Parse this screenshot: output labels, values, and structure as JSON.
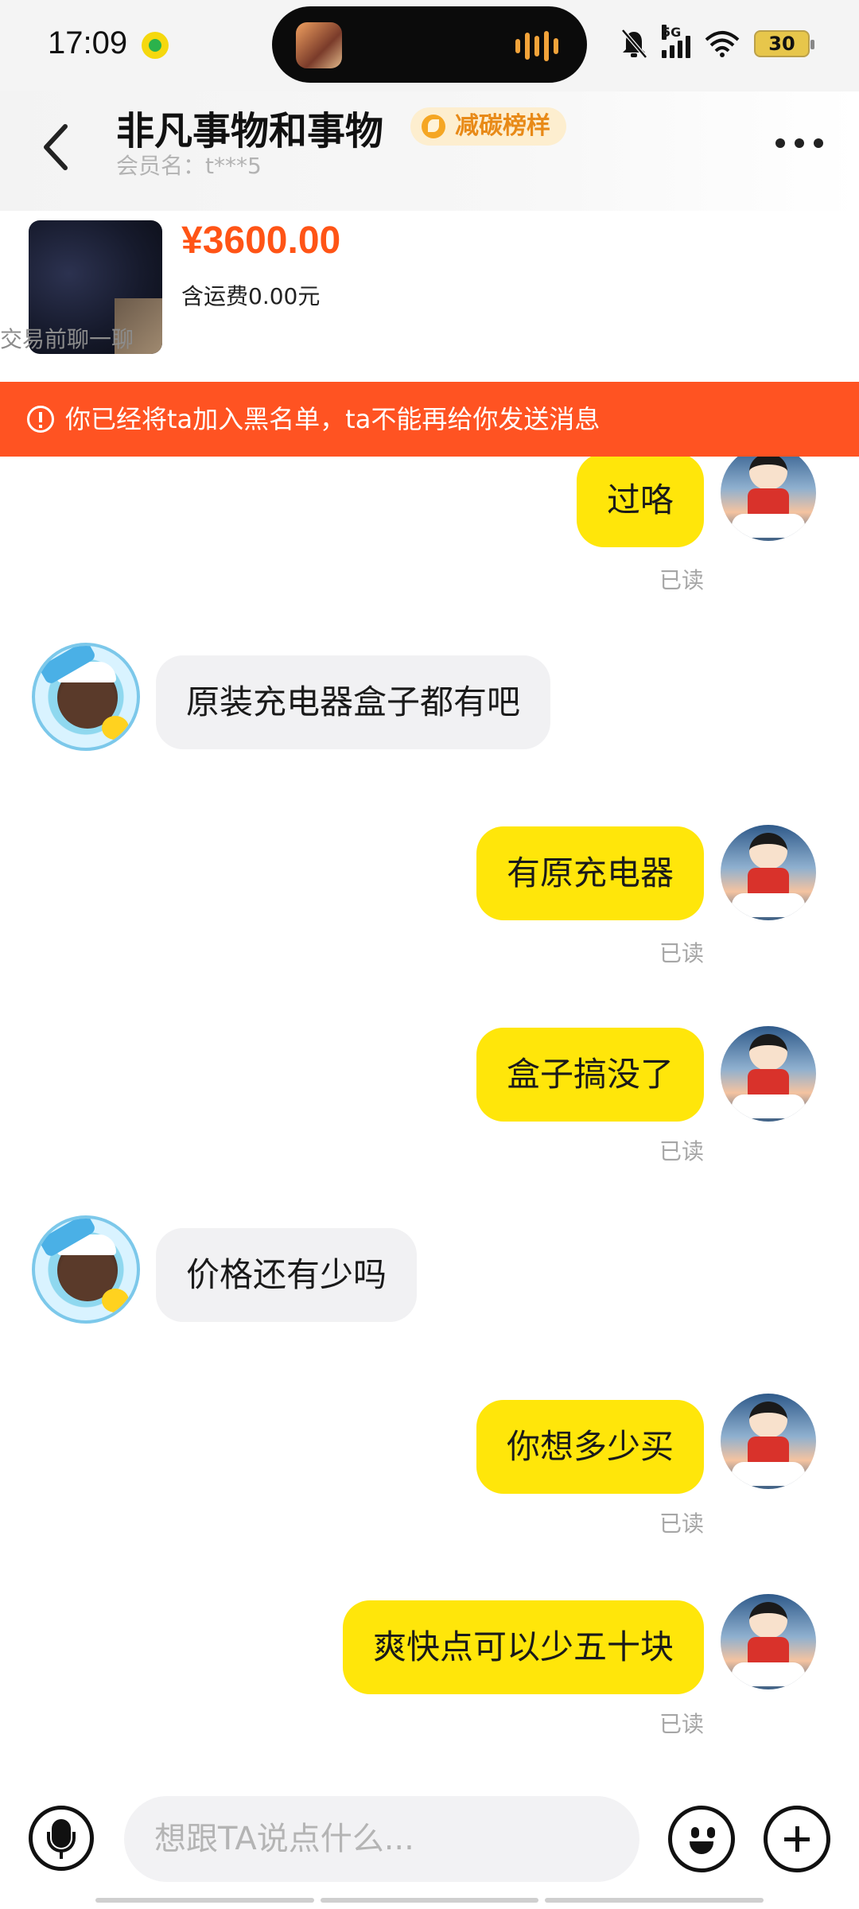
{
  "status_bar": {
    "time": "17:09",
    "network": "5G",
    "battery": "30",
    "icons": [
      "music-app-icon",
      "mute-bell-icon",
      "signal-icon",
      "wifi-icon",
      "battery-icon"
    ]
  },
  "header": {
    "shop_name": "非凡事物和事物",
    "badge": "减碳榜样",
    "member_name": "会员名：t***5"
  },
  "product": {
    "price": "¥3600.00",
    "shipping": "含运费0.00元",
    "note": "交易前聊一聊"
  },
  "banner": {
    "text": "你已经将ta加入黑名单，ta不能再给你发送消息"
  },
  "messages": [
    {
      "side": "out",
      "text": "过咯",
      "read": "已读"
    },
    {
      "side": "in",
      "text": "原装充电器盒子都有吧"
    },
    {
      "side": "out",
      "text": "有原充电器",
      "read": "已读"
    },
    {
      "side": "out",
      "text": "盒子搞没了",
      "read": "已读"
    },
    {
      "side": "in",
      "text": "价格还有少吗"
    },
    {
      "side": "out",
      "text": "你想多少买",
      "read": "已读"
    },
    {
      "side": "out",
      "text": "爽快点可以少五十块",
      "read": "已读"
    }
  ],
  "input_bar": {
    "placeholder": "想跟TA说点什么..."
  },
  "colors": {
    "accent_orange": "#ff5416",
    "banner": "#ff5322",
    "outgoing_bubble": "#ffe60a",
    "incoming_bubble": "#f1f1f3"
  }
}
